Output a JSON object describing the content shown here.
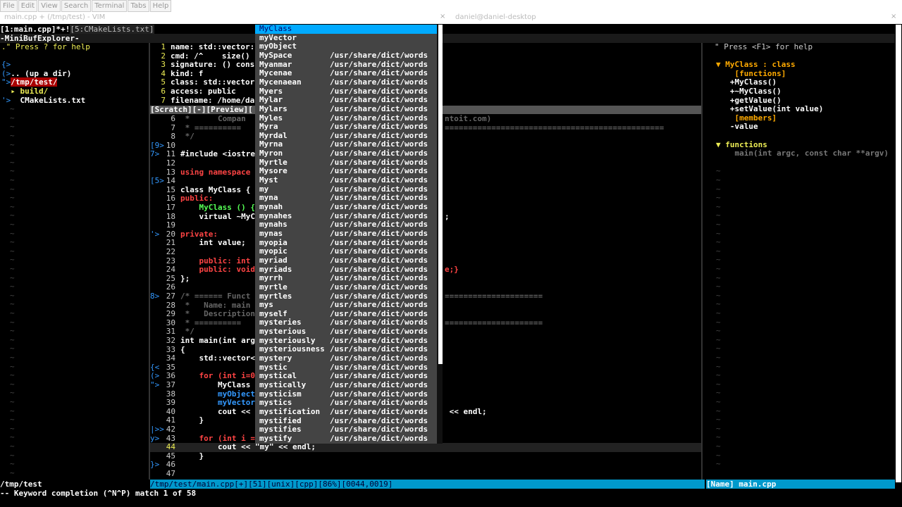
{
  "menu": [
    "File",
    "Edit",
    "View",
    "Search",
    "Terminal",
    "Tabs",
    "Help"
  ],
  "window_titles": [
    "main.cpp + (/tmp/test) - VIM",
    "daniel@daniel-desktop"
  ],
  "tabline": {
    "active": "[1:main.cpp]*+!",
    "inactive": "[5:CMakeLists.txt]"
  },
  "minibuf_title": "-MiniBufExplorer-",
  "explorer": {
    "help": ".\" Press ? for help",
    "lines": [
      {
        "mark": "{>",
        "text": ""
      },
      {
        "mark": "(>",
        "text": ".. (up a dir)"
      },
      {
        "mark": "\">",
        "text": "/tmp/test/"
      },
      {
        "mark": "",
        "text": "  ▸ build/"
      },
      {
        "mark": "'>",
        "text": "  CMakeLists.txt"
      }
    ]
  },
  "preview": [
    {
      "n": "1",
      "t": "name: std::vector:"
    },
    {
      "n": "2",
      "t": "cmd: /^    size()"
    },
    {
      "n": "3",
      "t": "signature: () cons"
    },
    {
      "n": "4",
      "t": "kind: f"
    },
    {
      "n": "5",
      "t": "class: std::vector"
    },
    {
      "n": "6",
      "t": "access: public"
    },
    {
      "n": "7",
      "t": "filename: /home/da"
    }
  ],
  "scratch_status": "[Scratch][-][Preview][",
  "code": [
    {
      "m": "",
      "n": "6",
      "t": " *      Compan",
      "tail": "ntoit.com)",
      "cls": "gray"
    },
    {
      "m": "",
      "n": "7",
      "t": " * ==========",
      "tail": "===============================================",
      "cls": "gray"
    },
    {
      "m": "",
      "n": "8",
      "t": " */",
      "tail": "",
      "cls": "gray"
    },
    {
      "m": "[9>",
      "n": "10",
      "t": "",
      "tail": "",
      "cls": ""
    },
    {
      "m": "7>",
      "n": "11",
      "t": "#include <iostre",
      "tail": "",
      "cls": "white"
    },
    {
      "m": "",
      "n": "12",
      "t": "",
      "tail": "",
      "cls": ""
    },
    {
      "m": "",
      "n": "13",
      "t": "using namespace",
      "tail": "",
      "cls": "red"
    },
    {
      "m": "[5>",
      "n": "14",
      "t": "",
      "tail": "",
      "cls": ""
    },
    {
      "m": "",
      "n": "15",
      "t": "class MyClass {",
      "tail": "",
      "cls": "white"
    },
    {
      "m": "",
      "n": "16",
      "t": "public:",
      "tail": "",
      "cls": "red"
    },
    {
      "m": "",
      "n": "17",
      "t": "    MyClass () {",
      "tail": "",
      "cls": "green"
    },
    {
      "m": "",
      "n": "18",
      "t": "    virtual ~MyC",
      "tail": ";",
      "cls": "white"
    },
    {
      "m": "",
      "n": "19",
      "t": "",
      "tail": "",
      "cls": ""
    },
    {
      "m": "'>",
      "n": "20",
      "t": "private:",
      "tail": "",
      "cls": "red"
    },
    {
      "m": "",
      "n": "21",
      "t": "    int value;",
      "tail": "",
      "cls": "white"
    },
    {
      "m": "",
      "n": "22",
      "t": "",
      "tail": "",
      "cls": ""
    },
    {
      "m": "",
      "n": "23",
      "t": "    public: int",
      "tail": "",
      "cls": "red"
    },
    {
      "m": "",
      "n": "24",
      "t": "    public: void",
      "tail": "e;}",
      "cls": "red"
    },
    {
      "m": "",
      "n": "25",
      "t": "};",
      "tail": "",
      "cls": "white"
    },
    {
      "m": "",
      "n": "26",
      "t": "",
      "tail": "",
      "cls": ""
    },
    {
      "m": "8>",
      "n": "27",
      "t": "/* ====== Funct",
      "tail": "=====================",
      "cls": "gray"
    },
    {
      "m": "",
      "n": "28",
      "t": " *   Name: main",
      "tail": "",
      "cls": "gray"
    },
    {
      "m": "",
      "n": "29",
      "t": " *   Description",
      "tail": "",
      "cls": "gray"
    },
    {
      "m": "",
      "n": "30",
      "t": " * ==========",
      "tail": "=====================",
      "cls": "gray"
    },
    {
      "m": "",
      "n": "31",
      "t": " */",
      "tail": "",
      "cls": "gray"
    },
    {
      "m": "",
      "n": "32",
      "t": "int main(int arg",
      "tail": "",
      "cls": "white"
    },
    {
      "m": "",
      "n": "33",
      "t": "{",
      "tail": "",
      "cls": "white"
    },
    {
      "m": "",
      "n": "34",
      "t": "    std::vector<",
      "tail": "",
      "cls": "white"
    },
    {
      "m": "{<",
      "n": "35",
      "t": "",
      "tail": "",
      "cls": ""
    },
    {
      "m": "(>",
      "n": "36",
      "t": "    for (int i=0",
      "tail": "",
      "cls": "red"
    },
    {
      "m": "\">",
      "n": "37",
      "t": "        MyClass",
      "tail": "",
      "cls": "white"
    },
    {
      "m": "",
      "n": "38",
      "t": "        myObject",
      "tail": "",
      "cls": "cyan"
    },
    {
      "m": "",
      "n": "39",
      "t": "        myVector",
      "tail": "",
      "cls": "cyan"
    },
    {
      "m": "",
      "n": "40",
      "t": "        cout <<",
      "tail": " << endl;",
      "cls": "white"
    },
    {
      "m": "",
      "n": "41",
      "t": "    }",
      "tail": "",
      "cls": "white"
    },
    {
      "m": "|>>",
      "n": "42",
      "t": "",
      "tail": "",
      "cls": ""
    },
    {
      "m": "y>",
      "n": "43",
      "t": "    for (int i =",
      "tail": "",
      "cls": "red"
    },
    {
      "m": "",
      "n": "44",
      "t": "        cout << \"my\" << endl;",
      "tail": "",
      "cls": "white"
    },
    {
      "m": "",
      "n": "45",
      "t": "    }",
      "tail": "",
      "cls": "white"
    },
    {
      "m": "}>",
      "n": "46",
      "t": "",
      "tail": "",
      "cls": ""
    },
    {
      "m": "",
      "n": "47",
      "t": "",
      "tail": "",
      "cls": ""
    }
  ],
  "completion": {
    "items": [
      {
        "w": "MyClass",
        "s": ""
      },
      {
        "w": "myVector",
        "s": ""
      },
      {
        "w": "myObject",
        "s": ""
      },
      {
        "w": "MySpace",
        "s": "/usr/share/dict/words"
      },
      {
        "w": "Myanmar",
        "s": "/usr/share/dict/words"
      },
      {
        "w": "Mycenae",
        "s": "/usr/share/dict/words"
      },
      {
        "w": "Mycenaean",
        "s": "/usr/share/dict/words"
      },
      {
        "w": "Myers",
        "s": "/usr/share/dict/words"
      },
      {
        "w": "Mylar",
        "s": "/usr/share/dict/words"
      },
      {
        "w": "Mylars",
        "s": "/usr/share/dict/words"
      },
      {
        "w": "Myles",
        "s": "/usr/share/dict/words"
      },
      {
        "w": "Myra",
        "s": "/usr/share/dict/words"
      },
      {
        "w": "Myrdal",
        "s": "/usr/share/dict/words"
      },
      {
        "w": "Myrna",
        "s": "/usr/share/dict/words"
      },
      {
        "w": "Myron",
        "s": "/usr/share/dict/words"
      },
      {
        "w": "Myrtle",
        "s": "/usr/share/dict/words"
      },
      {
        "w": "Mysore",
        "s": "/usr/share/dict/words"
      },
      {
        "w": "Myst",
        "s": "/usr/share/dict/words"
      },
      {
        "w": "my",
        "s": "/usr/share/dict/words"
      },
      {
        "w": "myna",
        "s": "/usr/share/dict/words"
      },
      {
        "w": "mynah",
        "s": "/usr/share/dict/words"
      },
      {
        "w": "mynahes",
        "s": "/usr/share/dict/words"
      },
      {
        "w": "mynahs",
        "s": "/usr/share/dict/words"
      },
      {
        "w": "mynas",
        "s": "/usr/share/dict/words"
      },
      {
        "w": "myopia",
        "s": "/usr/share/dict/words"
      },
      {
        "w": "myopic",
        "s": "/usr/share/dict/words"
      },
      {
        "w": "myriad",
        "s": "/usr/share/dict/words"
      },
      {
        "w": "myriads",
        "s": "/usr/share/dict/words"
      },
      {
        "w": "myrrh",
        "s": "/usr/share/dict/words"
      },
      {
        "w": "myrtle",
        "s": "/usr/share/dict/words"
      },
      {
        "w": "myrtles",
        "s": "/usr/share/dict/words"
      },
      {
        "w": "mys",
        "s": "/usr/share/dict/words"
      },
      {
        "w": "myself",
        "s": "/usr/share/dict/words"
      },
      {
        "w": "mysteries",
        "s": "/usr/share/dict/words"
      },
      {
        "w": "mysterious",
        "s": "/usr/share/dict/words"
      },
      {
        "w": "mysteriously",
        "s": "/usr/share/dict/words"
      },
      {
        "w": "mysteriousness",
        "s": "/usr/share/dict/words"
      },
      {
        "w": "mystery",
        "s": "/usr/share/dict/words"
      },
      {
        "w": "mystic",
        "s": "/usr/share/dict/words"
      },
      {
        "w": "mystical",
        "s": "/usr/share/dict/words"
      },
      {
        "w": "mystically",
        "s": "/usr/share/dict/words"
      },
      {
        "w": "mysticism",
        "s": "/usr/share/dict/words"
      },
      {
        "w": "mystics",
        "s": "/usr/share/dict/words"
      },
      {
        "w": "mystification",
        "s": "/usr/share/dict/words"
      },
      {
        "w": "mystified",
        "s": "/usr/share/dict/words"
      },
      {
        "w": "mystifies",
        "s": "/usr/share/dict/words"
      },
      {
        "w": "mystify",
        "s": "/usr/share/dict/words"
      }
    ]
  },
  "taglist": {
    "help": "\" Press <F1> for help",
    "lines": [
      {
        "t": "▼ MyClass : class",
        "cls": "class"
      },
      {
        "t": "    [functions]",
        "cls": "orange"
      },
      {
        "t": "   +MyClass()",
        "cls": "fn"
      },
      {
        "t": "   +~MyClass()",
        "cls": "fn"
      },
      {
        "t": "   +getValue()",
        "cls": "fn"
      },
      {
        "t": "   +setValue(int value)",
        "cls": "fn"
      },
      {
        "t": "    [members]",
        "cls": "orange"
      },
      {
        "t": "   -value",
        "cls": "fn"
      },
      {
        "t": "",
        "cls": ""
      },
      {
        "t": "▼ functions",
        "cls": "yellowhead"
      },
      {
        "t": "    main(int argc, const char **argv)",
        "cls": "mainfn"
      }
    ]
  },
  "status": {
    "left": "/tmp/test",
    "mid": " /tmp/test/main.cpp[+][51][unix][cpp][86%][0044,0019]",
    "right": "[Name] main.cpp"
  },
  "cmdline": "-- Keyword completion (^N^P) match 1 of 58"
}
